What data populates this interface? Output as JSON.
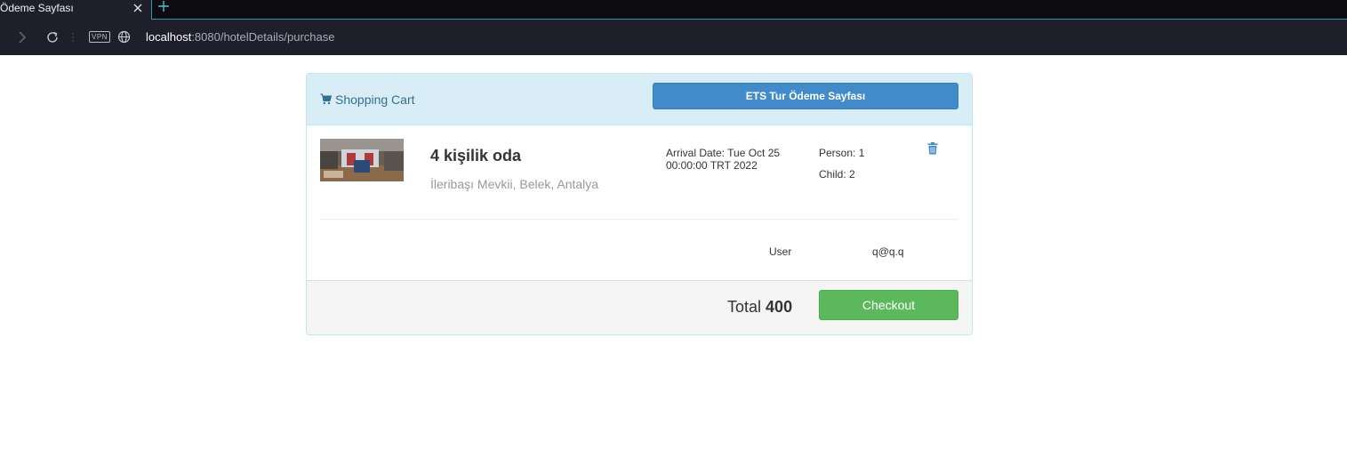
{
  "browser": {
    "tab_title": "Ödeme Sayfası",
    "vpn_label": "VPN",
    "url_host": "localhost",
    "url_rest": ":8080/hotelDetails/purchase"
  },
  "cart": {
    "title": "Shopping Cart",
    "header_button": "ETS Tur Ödeme Sayfası",
    "item": {
      "name": "4 kişilik oda",
      "address": "İleribaşı Mevkii, Belek, Antalya",
      "arrival": "Arrival Date: Tue Oct 25 00:00:00 TRT 2022",
      "person": "Person: 1",
      "child": "Child: 2"
    },
    "user_label": "User",
    "user_value": "q@q.q",
    "total_label": "Total",
    "total_value": "400",
    "checkout_label": "Checkout"
  },
  "colors": {
    "panel_header_bg": "#d9edf7",
    "primary_button": "#428bca",
    "success_button": "#5cb85c",
    "trash_icon": "#428bca"
  }
}
